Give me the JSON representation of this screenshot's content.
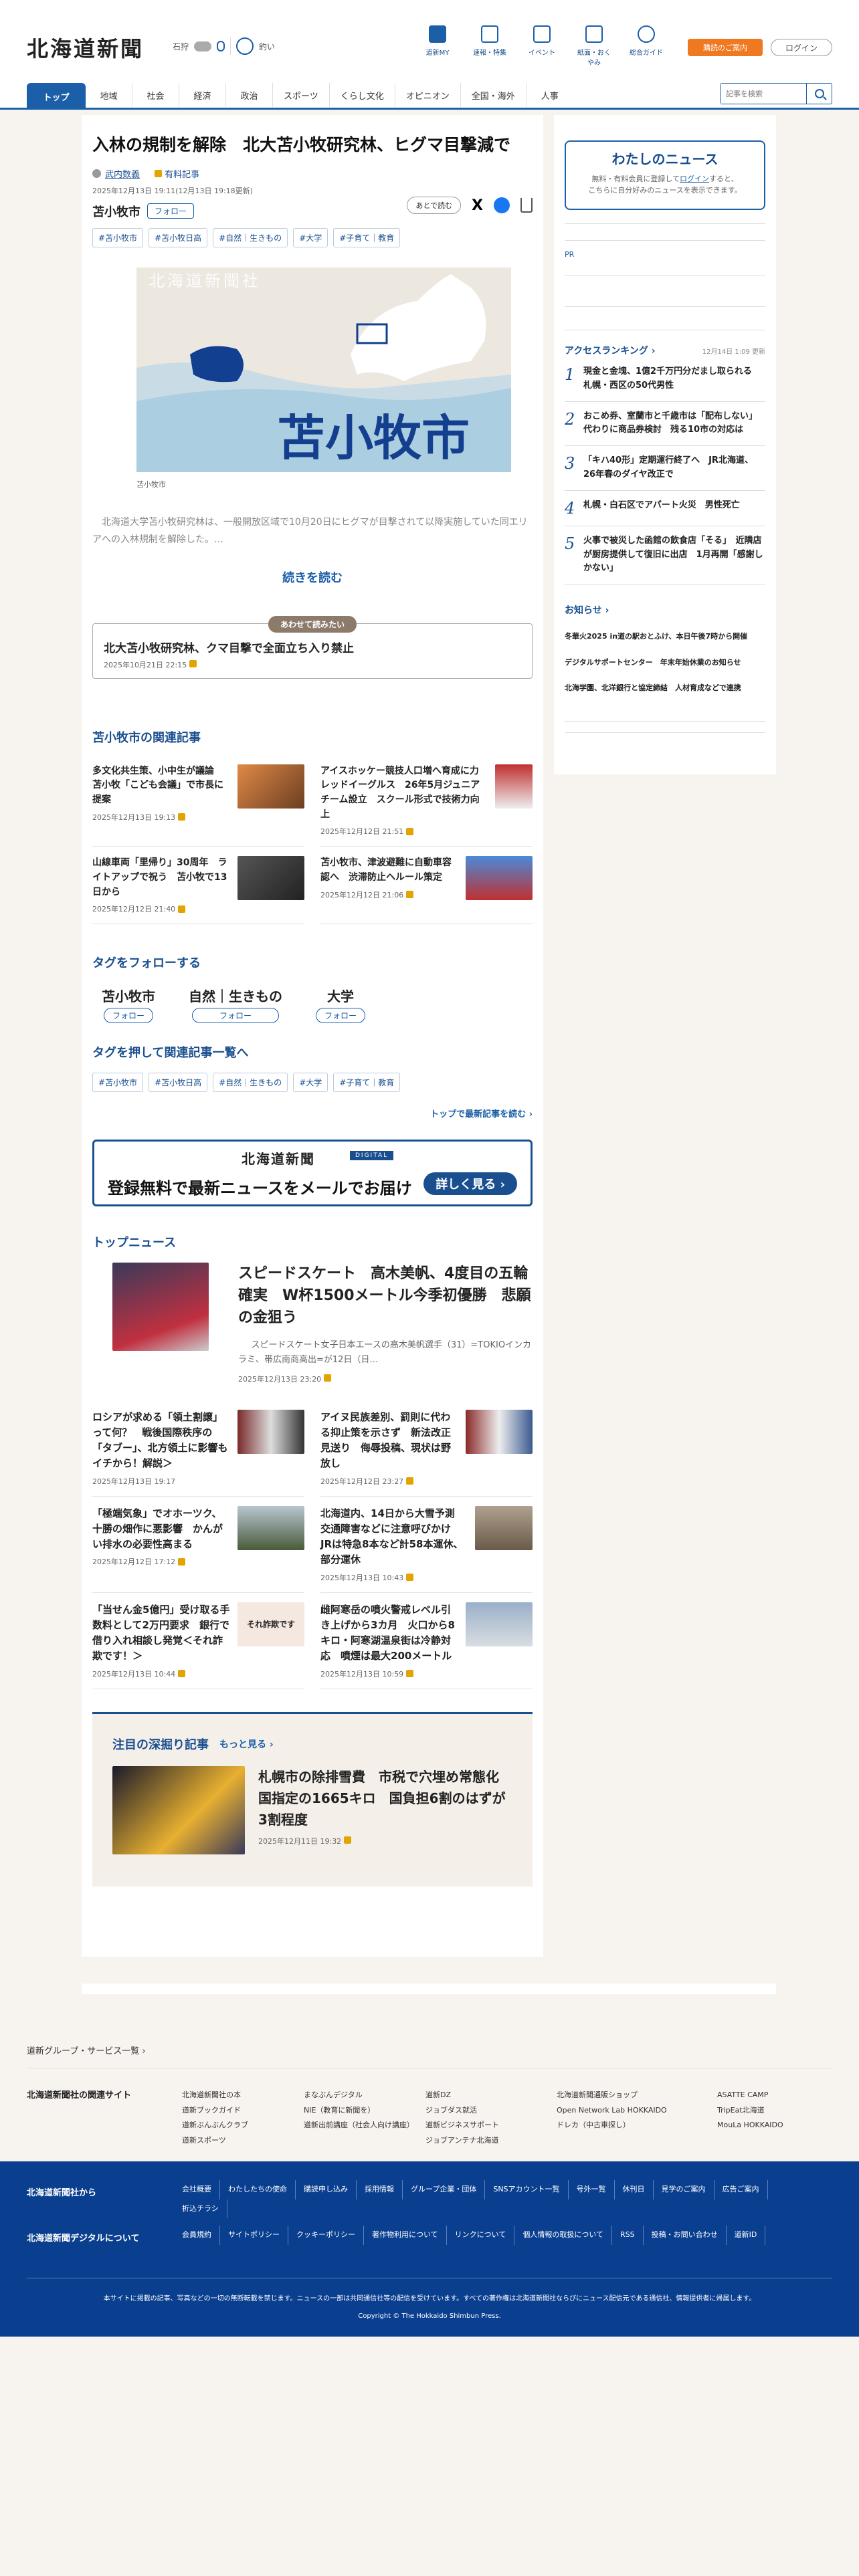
{
  "header": {
    "logo": "北海道新聞",
    "weather": {
      "city": "石狩",
      "rain": "0%",
      "clock_label": "釣い"
    },
    "nav": [
      {
        "label": "道新MY",
        "icon": "mydoshin-icon"
      },
      {
        "label": "速報・特集",
        "icon": "flag-icon"
      },
      {
        "label": "イベント",
        "icon": "calendar-icon"
      },
      {
        "label": "紙面・おくやみ",
        "icon": "paper-icon"
      },
      {
        "label": "総合ガイド",
        "icon": "help-icon"
      }
    ],
    "purchase_label": "購読のご案内",
    "login_label": "ログイン"
  },
  "categories": [
    "トップ",
    "地域",
    "社会",
    "経済",
    "政治",
    "スポーツ",
    "くらし文化",
    "オピニオン",
    "全国・海外",
    "人事"
  ],
  "search": {
    "placeholder": "記事を検索"
  },
  "article": {
    "title": "入林の規制を解除　北大苫小牧研究林、ヒグマ目撃減で",
    "author": "武内数義",
    "member_label": "有料記事",
    "dates": "2025年12月13日 19:11(12月13日 19:18更新)",
    "read_later": "あとで読む",
    "primary_tag": "苫小牧市",
    "follow_label": "フォロー",
    "tags": [
      "#苫小牧市",
      "#苫小牧日高",
      "#自然｜生きもの",
      "#大学",
      "#子育て｜教育"
    ],
    "map_label": "苫小牧市",
    "map_watermark": "北海道新聞社",
    "caption": "苫小牧市",
    "lead": "北海道大学苫小牧研究林は、一般開放区域で10月20日にヒグマが目撃されて以降実施していた同エリアへの入林規制を解除した。…",
    "read_more": "続きを読む",
    "recommend_badge": "あわせて読みたい",
    "recommend_title": "北大苫小牧研究林、クマ目撃で全面立ち入り禁止",
    "recommend_date": "2025年10月21日 22:15"
  },
  "related": {
    "heading": "苫小牧市の関連記事",
    "items": [
      {
        "title": "多文化共生策、小中生が議論　苫小牧「こども会議」で市長に提案",
        "date": "2025年12月13日 19:13"
      },
      {
        "title": "アイスホッケー競技人口増へ育成に力　レッドイーグルス　26年5月ジュニアチーム設立　スクール形式で技術力向上",
        "date": "2025年12月12日 21:51"
      },
      {
        "title": "山線車両「里帰り」30周年　ライトアップで祝う　苫小牧で13日から",
        "date": "2025年12月12日 21:40"
      },
      {
        "title": "苫小牧市、津波避難に自動車容認へ　渋滞防止ヘルール策定",
        "date": "2025年12月12日 21:06"
      }
    ]
  },
  "follow_tags": {
    "heading": "タグをフォローする",
    "items": [
      "苫小牧市",
      "自然｜生きもの",
      "大学"
    ],
    "button": "フォロー"
  },
  "tag_list": {
    "heading": "タグを押して関連記事一覧へ",
    "items": [
      "#苫小牧市",
      "#苫小牧日高",
      "#自然｜生きもの",
      "#大学",
      "#子育て｜教育"
    ],
    "to_latest": "トップで最新記事を読む"
  },
  "digital_banner": {
    "logo": "北海道新聞",
    "badge": "DIGITAL",
    "text": "登録無料で最新ニュースをメールでお届け",
    "button": "詳しく見る"
  },
  "top_news": {
    "heading": "トップニュース",
    "lead_title": "スピードスケート　高木美帆、4度目の五輪確実　W杯1500メートル今季初優勝　悲願の金狙う",
    "lead_text": "スピードスケート女子日本エースの高木美帆選手（31）=TOKIOインカラミ、帯広南商高出=が12日（日…",
    "lead_date": "2025年12月13日 23:20",
    "items": [
      {
        "title": "ロシアが求める「領土割譲」って何？　戦後国際秩序の「タブー」、北方領土に影響もイチから！解説＞",
        "date": "2025年12月13日 19:17"
      },
      {
        "title": "アイヌ民族差別、罰則に代わる抑止策を示さず　新法改正見送り　侮辱投稿、現状は野放し",
        "date": "2025年12月12日 23:27"
      },
      {
        "title": "「極端気象」でオホーツク、十勝の畑作に悪影響　かんがい排水の必要性高まる",
        "date": "2025年12月12日 17:12"
      },
      {
        "title": "北海道内、14日から大雪予測　交通障害などに注意呼びかけ　JRは特急8本など計58本運休、部分運休",
        "date": "2025年12月13日 10:43"
      },
      {
        "title": "「当せん金5億円」受け取る手数料として2万円要求　銀行で借り入れ相談し発覚＜それ詐欺です！＞",
        "date": "2025年12月13日 10:44"
      },
      {
        "title": "雌阿寒岳の噴火警戒レベル引き上げから3カ月　火口から8キロ・阿寒湖温泉街は冷静対応　噴煙は最大200メートル",
        "date": "2025年12月13日 10:59"
      }
    ],
    "thumb_caption": "それ詐欺です"
  },
  "deep_dive": {
    "heading": "注目の深掘り記事",
    "more": "もっと見る",
    "title": "札幌市の除排雪費　市税で穴埋め常態化　国指定の1665キロ　国負担6割のはずが3割程度",
    "date": "2025年12月11日 19:32"
  },
  "sidebar": {
    "mynews_title": "わたしのニュース",
    "mynews_text1": "無料・有料会員に登録して",
    "mynews_login": "ログイン",
    "mynews_text2": "すると、",
    "mynews_text3": "こちらに自分好みのニュースを表示できます。",
    "pr_label": "PR",
    "ranking_heading": "アクセスランキング",
    "ranking_updated": "12月14日 1:09 更新",
    "ranking": [
      {
        "rank": "1",
        "title": "現金と金塊、1億2千万円分だまし取られる　札幌・西区の50代男性"
      },
      {
        "rank": "2",
        "title": "おこめ券、室蘭市と千歳市は「配布しない」代わりに商品券検討　残る10市の対応は"
      },
      {
        "rank": "3",
        "title": "「キハ40形」定期運行終了へ　JR北海道、26年春のダイヤ改正で"
      },
      {
        "rank": "4",
        "title": "札幌・白石区でアパート火災　男性死亡"
      },
      {
        "rank": "5",
        "title": "火事で被災した函館の飲食店「そる」　近隣店が厨房提供して復旧に出店　1月再開「感謝しかない」"
      }
    ],
    "notice_heading": "お知らせ",
    "notices": [
      "冬華火2025 in道の駅おとふけ、本日午後7時から開催",
      "デジタルサポートセンター　年末年始休業のお知らせ",
      "北海学園、北洋銀行と協定締結　人材育成などで連携"
    ]
  },
  "footer": {
    "group_heading": "道新グループ・サービス一覧",
    "related_heading": "北海道新聞社の関連サイト",
    "cols": [
      [
        "北海道新聞社の本",
        "道新ブックガイド",
        "道新ぶんぶんクラブ",
        "道新スポーツ"
      ],
      [
        "まなぶんデジタル",
        "NIE（教育に新聞を）",
        "道新出前講座（社会人向け講座）"
      ],
      [
        "道新DZ",
        "ジョブダス就活",
        "道新ビジネスサポート",
        "ジョブアンテナ北海道"
      ],
      [
        "北海道新聞通販ショップ",
        "Open Network Lab HOKKAIDO",
        "ドレカ（中古車探し）"
      ],
      [
        "ASATTE CAMP",
        "TripEat北海道",
        "MouLa HOKKAIDO"
      ]
    ],
    "company_heading": "北海道新聞社から",
    "company_links": [
      "会社概要",
      "わたしたちの使命",
      "購読申し込み",
      "採用情報",
      "グループ企業・団体",
      "SNSアカウント一覧",
      "号外一覧",
      "休刊日",
      "見学のご案内",
      "広告ご案内",
      "折込チラシ"
    ],
    "digital_heading": "北海道新聞デジタルについて",
    "digital_links": [
      "会員規約",
      "サイトポリシー",
      "クッキーポリシー",
      "著作物利用について",
      "リンクについて",
      "個人情報の取扱について",
      "RSS",
      "投稿・お問い合わせ",
      "道新ID"
    ],
    "note": "本サイトに掲載の記事、写真などの一切の無断転載を禁じます。ニュースの一部は共同通信社等の配信を受けています。すべての著作権は北海道新聞社ならびにニュース配信元である通信社、情報提供者に帰属します。",
    "copyright": "Copyright © The Hokkaido Shimbun Press."
  }
}
